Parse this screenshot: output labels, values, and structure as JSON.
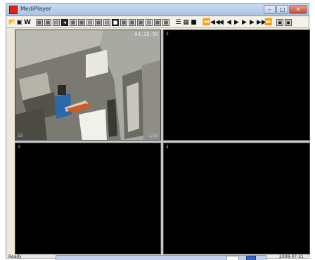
{
  "window": {
    "title": "MediPlayer"
  },
  "titlebar_buttons": {
    "minimize": "–",
    "maximize": "□",
    "close": "✕"
  },
  "toolbar": {
    "groups": [
      [
        "open-icon",
        "save-icon",
        "w-icon"
      ],
      [
        "layout-1-icon",
        "layout-2-icon",
        "layout-3-icon",
        "layout-4-icon",
        "layout-5-icon",
        "layout-6-icon",
        "layout-7-icon",
        "layout-8-icon",
        "layout-9-icon",
        "layout-10-icon",
        "layout-11-icon",
        "layout-12-icon",
        "layout-13-icon",
        "layout-14-icon",
        "layout-15-icon",
        "layout-16-icon"
      ],
      [
        "list-icon",
        "grid-icon",
        "stop-icon"
      ],
      [
        "rewind-fast-icon",
        "rewind-icon",
        "step-back-icon",
        "prev-icon",
        "next-icon",
        "step-forward-icon",
        "play-icon",
        "forward-icon",
        "forward-fast-icon"
      ],
      [
        "capture-icon",
        "settings-icon"
      ]
    ],
    "w_label": "W"
  },
  "panes": [
    {
      "label": "1",
      "time": "04:28:59",
      "corner_left": "15",
      "corner_right": "1/15"
    },
    {
      "label": "2"
    },
    {
      "label": "3"
    },
    {
      "label": "4"
    }
  ],
  "status": {
    "text": "Ready",
    "date": "2008-07-21",
    "playback_position": 0.95
  }
}
